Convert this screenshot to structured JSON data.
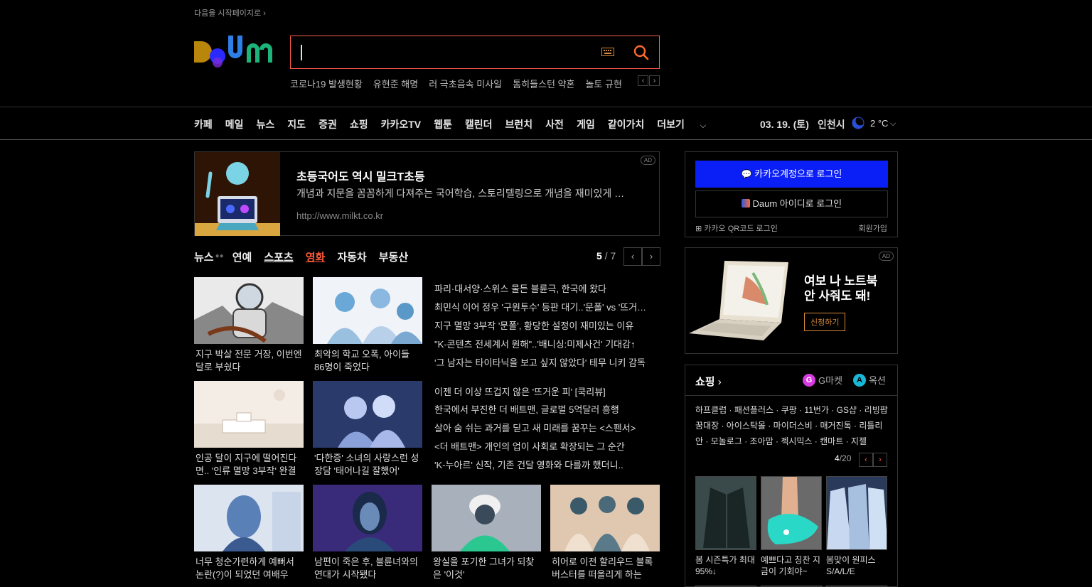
{
  "top": {
    "set_home": "다음을 시작페이지로",
    "set_home_arrow": "›",
    "logo_alt": "Daum",
    "search_placeholder": "",
    "trending": [
      "코로나19 발생현황",
      "유현준 해명",
      "러 극초음속 미사일",
      "톰히들스턴 약혼",
      "놀토 규현"
    ],
    "trend_prev": "‹",
    "trend_next": "›"
  },
  "gnb": {
    "items": [
      "카페",
      "메일",
      "뉴스",
      "지도",
      "증권",
      "쇼핑",
      "카카오TV",
      "웹툰",
      "캘린더",
      "브런치",
      "사전",
      "게임",
      "같이가치",
      "더보기"
    ],
    "more_chevron": "⌵",
    "date": "03. 19. (토)",
    "city": "인천시",
    "temp": "2 °C",
    "weather_chevron": "⌵"
  },
  "ad_banner": {
    "title": "초등국어도 역시 밀크T초등",
    "desc": "개념과 지문을 꼼꼼하게 다져주는 국어학습, 스토리텔링으로 개념을 재미있게 익혀요",
    "url": "http://www.milkt.co.kr",
    "badge": "AD"
  },
  "news": {
    "tabs": [
      "뉴스",
      "연예",
      "스포츠",
      "영화",
      "자동차",
      "부동산"
    ],
    "active_tab": "영화",
    "page_current": "5",
    "page_sep": " / ",
    "page_total": "7",
    "prev": "‹",
    "next": "›",
    "row1_captions": [
      "지구 박살 전문 거장, 이번엔 달로 부쉈다",
      "최악의 학교 오폭, 아이들 86명이 죽었다"
    ],
    "row1_headlines": [
      "파리·대서양·스위스 물든 블륜극, 한국에 왔다",
      "최민식 이어 정우 '구원투수' 등판 대기..'문폴' vs '뜨거운 피'",
      "지구 멸망 3부작 '문폴', 황당한 설정이 재미있는 이유",
      "\"K-콘텐츠 전세계서 원해\"..'배니싱:미제사건' 기대감↑",
      "'그 남자는 타이타닉을 보고 싶지 않았다' 테무 니키 감독"
    ],
    "row2_captions": [
      "인공 달이 지구에 떨어진다면.. '인류 멸망 3부작' 완결",
      "'다한증' 소녀의 사랑스런 성장담 '태어나길 잘했어'"
    ],
    "row2_headlines": [
      "이젠 더 이상 뜨겁지 않은 '뜨거운 피' [쿡리뷰]",
      "한국에서 부진한 더 배트맨, 글로벌 5억달러 흥행",
      "살아 숨 쉬는 과거를 딛고 새 미래를 꿈꾸는 <스펜서>",
      "<더 배트맨> 개인의 업이 사회로 확장되는 그 순간",
      "'K-누아르' 신작, 기존 건달 영화와 다를까 했더니.."
    ],
    "row3_captions": [
      "너무 청순가련하게 예뻐서 논란(?)이 되었던 여배우",
      "남편이 죽은 후, 블륜녀와의 연대가 시작됐다",
      "왕실을 포기한 그녀가 되찾은 '이것'",
      "히어로 이전 할리우드 블록버스터를 떠올리게 하는"
    ]
  },
  "login": {
    "kakao_label": "카카오계정으로 로그인",
    "daum_label": "Daum 아이디로 로그인",
    "qr_label": "카카오 QR코드 로그인",
    "join_label": "회원가입"
  },
  "ad2": {
    "title": "여보 나 노트북 안 사줘도 돼!",
    "button": "신청하기",
    "badge": "AD"
  },
  "shopping": {
    "title": "쇼핑",
    "title_arrow": "›",
    "gmarket": "G마켓",
    "auction": "옥션",
    "links": "하프클럽 · 패션플러스 · 쿠팡 · 11번가 · GS샵 · 리빙팝꿈대장 · 아이스탁몰 · 마이더스비 · 매거진톡 · 리틀리안 · 모놀로그 · 조아맘 · 젝시믹스 · 캔마트 · 지젤",
    "page_current": "4",
    "page_total": "/20",
    "prev": "‹",
    "next": "›",
    "products": [
      "봄 시즌특가 최대 95%↓",
      "예쁘다고 칭찬 지금이 기회야~",
      "봄맞이 원피스 S/A/L/E"
    ]
  },
  "colors": {
    "accent": "#ff5a3a",
    "kakao_blue": "#0a1ff6",
    "background": "#000000"
  }
}
